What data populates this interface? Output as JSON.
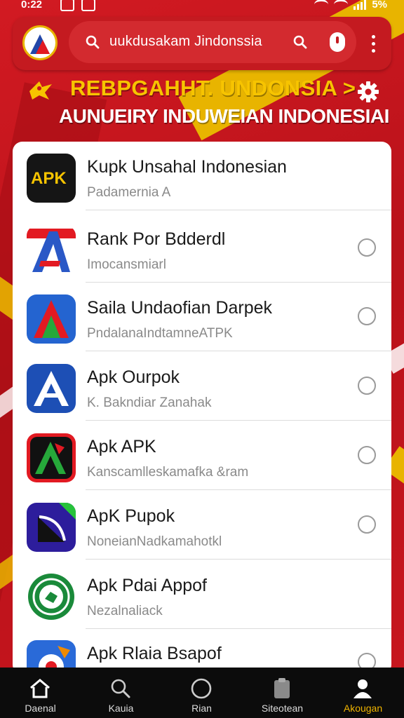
{
  "status_bar": {
    "time": "0:22",
    "battery": "5%"
  },
  "search": {
    "query": "uukdusakam Jindonssia"
  },
  "banner": {
    "title": "REBPGAHHT. UNDONSIA >",
    "subtitle": "AUNUEIRY INDUWEIAN INDONESIAI"
  },
  "apps": [
    {
      "name": "Kupk Unsahal Indonesian",
      "subtitle": "Padamernia A",
      "icon": "apk-icon"
    },
    {
      "name": "Rank Por Bdderdl",
      "subtitle": "Imocansmiarl",
      "icon": "flag-a-icon"
    },
    {
      "name": "Saila Undaofian Darpek",
      "subtitle": "PndalanaIndtamneATPK",
      "icon": "triangle-a-icon"
    },
    {
      "name": "Apk Ourpok",
      "subtitle": "K. Bakndiar Zanahak",
      "icon": "blue-a-icon"
    },
    {
      "name": "Apk APK",
      "subtitle": "Kanscamlleskamafka &ram",
      "icon": "black-a-icon"
    },
    {
      "name": "ApK Pupok",
      "subtitle": "NoneianNadkamahotkl",
      "icon": "arrow-icon"
    },
    {
      "name": "Apk Pdai Appof",
      "subtitle": "Nezalnaliack",
      "icon": "seal-icon"
    },
    {
      "name": "Apk Rlaia Bsapof",
      "subtitle": "",
      "icon": "gear-app-icon"
    }
  ],
  "nav": [
    {
      "label": "Daenal",
      "icon": "home-icon",
      "active": false
    },
    {
      "label": "Kauia",
      "icon": "search-icon",
      "active": false
    },
    {
      "label": "Rian",
      "icon": "circle-icon",
      "active": false
    },
    {
      "label": "Siteotean",
      "icon": "clipboard-icon",
      "active": false
    },
    {
      "label": "Akougan",
      "icon": "profile-icon",
      "active": true
    }
  ],
  "colors": {
    "primary_red": "#c8161e",
    "accent_yellow": "#f7c400",
    "nav_active": "#f0b400"
  }
}
